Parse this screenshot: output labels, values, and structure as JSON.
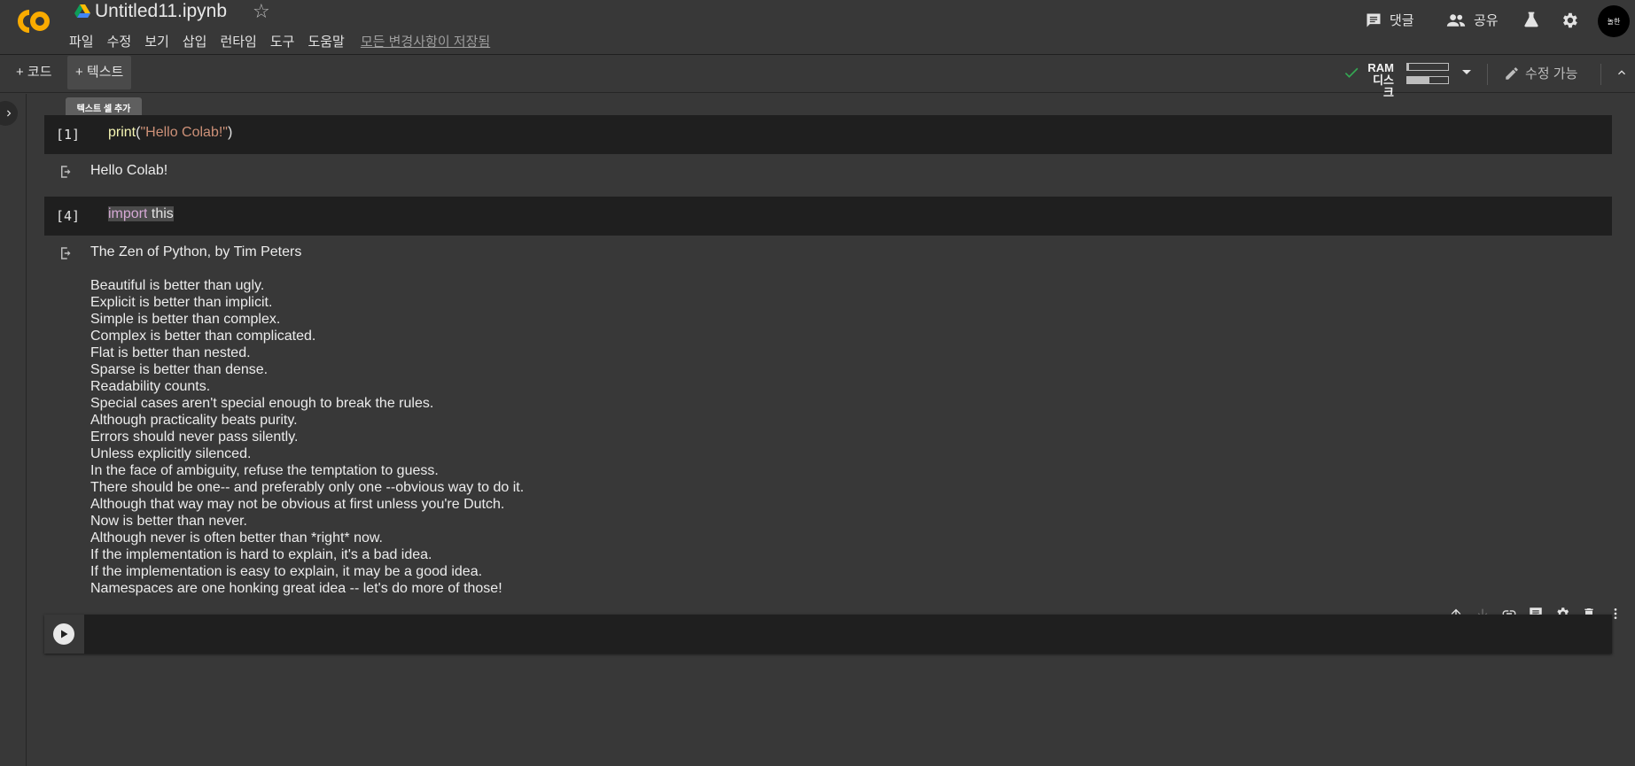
{
  "header": {
    "logo_text": "CO",
    "notebook_title": "Untitled11.ipynb",
    "menu": [
      "파일",
      "수정",
      "보기",
      "삽입",
      "런타임",
      "도구",
      "도움말"
    ],
    "saved_status": "모든 변경사항이 저장됨",
    "comment_label": "댓글",
    "share_label": "공유",
    "avatar_text": "놀한"
  },
  "toolbar": {
    "add_code_label": "+ 코드",
    "add_text_label": "+ 텍스트",
    "tooltip": "텍스트 셀 추가",
    "ram_label": "RAM",
    "disk_label": "디스크",
    "ram_usage": 0.05,
    "disk_usage": 0.55,
    "edit_label": "수정 가능"
  },
  "cells": [
    {
      "exec_count": "[1]",
      "code": {
        "fn": "print",
        "open": "(",
        "str": "\"Hello Colab!\"",
        "close": ")"
      },
      "output": "Hello Colab!"
    },
    {
      "exec_count": "[4]",
      "code": {
        "kw": "import",
        "rest": " this"
      },
      "output_title": "The Zen of Python, by Tim Peters",
      "output_lines": "Beautiful is better than ugly.\nExplicit is better than implicit.\nSimple is better than complex.\nComplex is better than complicated.\nFlat is better than nested.\nSparse is better than dense.\nReadability counts.\nSpecial cases aren't special enough to break the rules.\nAlthough practicality beats purity.\nErrors should never pass silently.\nUnless explicitly silenced.\nIn the face of ambiguity, refuse the temptation to guess.\nThere should be one-- and preferably only one --obvious way to do it.\nAlthough that way may not be obvious at first unless you're Dutch.\nNow is better than never.\nAlthough never is often better than *right* now.\nIf the implementation is hard to explain, it's a bad idea.\nIf the implementation is easy to explain, it may be a good idea.\nNamespaces are one honking great idea -- let's do more of those!"
    }
  ],
  "colors": {
    "background": "#383838",
    "cell_bg": "#1f1f1f",
    "logo_orange": "#f9ab00",
    "check_green": "#34a853"
  }
}
